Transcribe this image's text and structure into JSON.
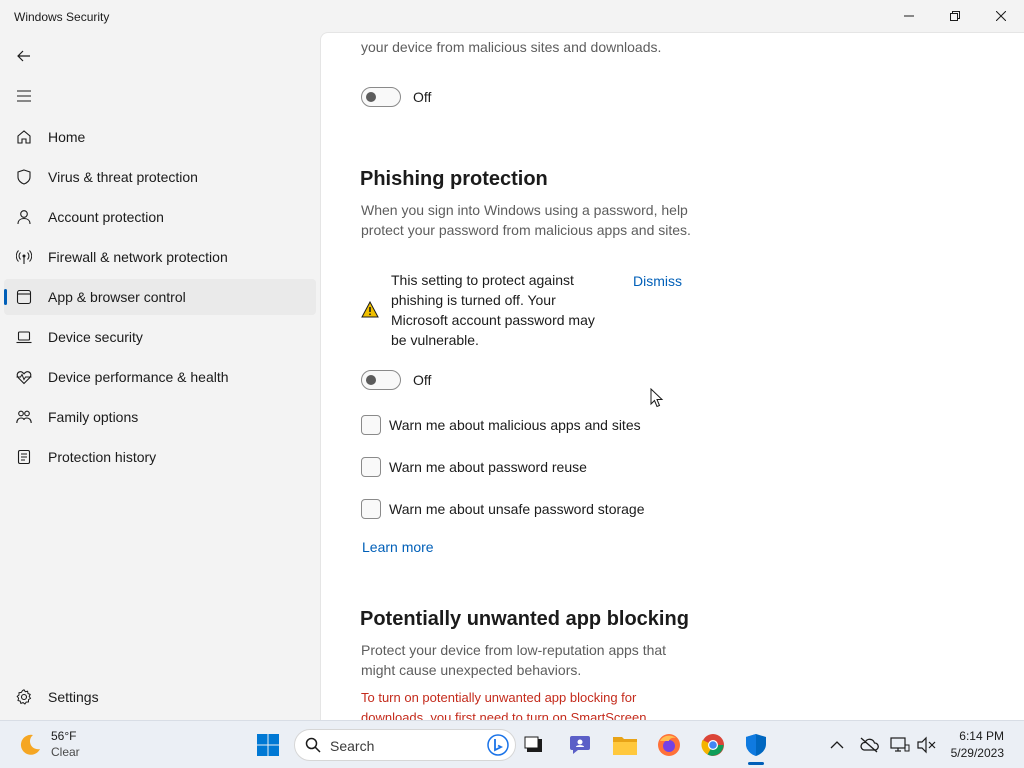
{
  "window": {
    "title": "Windows Security"
  },
  "sidebar": {
    "items": [
      {
        "label": "Home",
        "icon": "home-icon"
      },
      {
        "label": "Virus & threat protection",
        "icon": "shield-icon"
      },
      {
        "label": "Account protection",
        "icon": "person-icon"
      },
      {
        "label": "Firewall & network protection",
        "icon": "wireless-icon"
      },
      {
        "label": "App & browser control",
        "icon": "app-window-icon",
        "selected": true
      },
      {
        "label": "Device security",
        "icon": "laptop-icon"
      },
      {
        "label": "Device performance & health",
        "icon": "heart-pulse-icon"
      },
      {
        "label": "Family options",
        "icon": "family-icon"
      },
      {
        "label": "Protection history",
        "icon": "history-icon"
      }
    ],
    "settings_label": "Settings"
  },
  "content": {
    "top_text": "your device from malicious sites and downloads.",
    "top_toggle_state": "Off",
    "phishing": {
      "heading": "Phishing protection",
      "description": "When you sign into Windows using a password, help protect your password from malicious apps and sites.",
      "warning_lines": [
        "This setting to protect against",
        "phishing is turned off. Your",
        "Microsoft account password may",
        "be vulnerable."
      ],
      "dismiss_label": "Dismiss",
      "toggle_state": "Off",
      "checkboxes": [
        {
          "label": "Warn me about malicious apps and sites",
          "checked": false
        },
        {
          "label": "Warn me about password reuse",
          "checked": false
        },
        {
          "label": "Warn me about unsafe password storage",
          "checked": false
        }
      ],
      "learn_more": "Learn more"
    },
    "pua": {
      "heading": "Potentially unwanted app blocking",
      "description": "Protect your device from low-reputation apps that might cause unexpected behaviors.",
      "red_lines": [
        "To turn on potentially unwanted app blocking for",
        "downloads, you first need to turn on SmartScreen"
      ]
    }
  },
  "taskbar": {
    "weather_temp": "56°F",
    "weather_condition": "Clear",
    "search_placeholder": "Search",
    "time": "6:14 PM",
    "date": "5/29/2023"
  },
  "colors": {
    "accent": "#005fb8",
    "error": "#c42b1c",
    "warning": "#f0c000"
  }
}
